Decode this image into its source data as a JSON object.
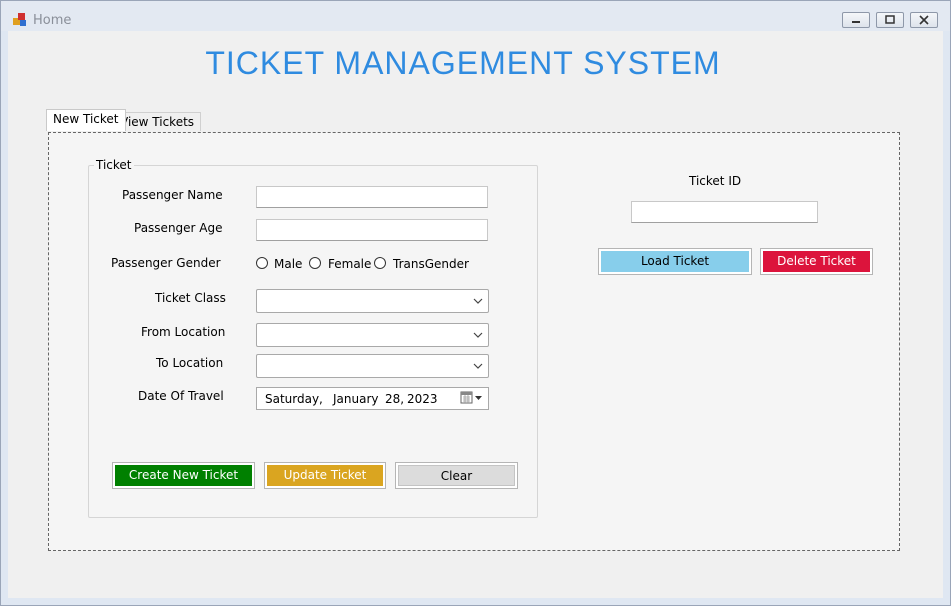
{
  "window": {
    "title": "Home"
  },
  "heading": "TICKET MANAGEMENT SYSTEM",
  "tabs": [
    {
      "label": "New Ticket",
      "active": true
    },
    {
      "label": "View Tickets",
      "active": false
    }
  ],
  "form": {
    "group_label": "Ticket",
    "passenger_name": {
      "label": "Passenger Name",
      "value": ""
    },
    "passenger_age": {
      "label": "Passenger Age",
      "value": ""
    },
    "gender": {
      "label": "Passenger Gender",
      "options": [
        "Male",
        "Female",
        "TransGender"
      ],
      "selected": null
    },
    "ticket_class": {
      "label": "Ticket Class",
      "value": ""
    },
    "from_location": {
      "label": "From Location",
      "value": ""
    },
    "to_location": {
      "label": "To Location",
      "value": ""
    },
    "date_of_travel": {
      "label": "Date Of Travel",
      "day_name": "Saturday",
      "separator": ",",
      "month": "January",
      "day": "28,",
      "year": "2023"
    },
    "buttons": {
      "create": "Create New Ticket",
      "update": "Update Ticket",
      "clear": "Clear"
    }
  },
  "lookup": {
    "ticket_id_label": "Ticket ID",
    "ticket_id_value": "",
    "load_button": "Load Ticket",
    "delete_button": "Delete Ticket"
  },
  "colors": {
    "heading": "#2f8be0",
    "create": "#008000",
    "update": "#daa520",
    "clear": "#dcdcdc",
    "load": "#87ceeb",
    "delete": "#dc143c"
  }
}
